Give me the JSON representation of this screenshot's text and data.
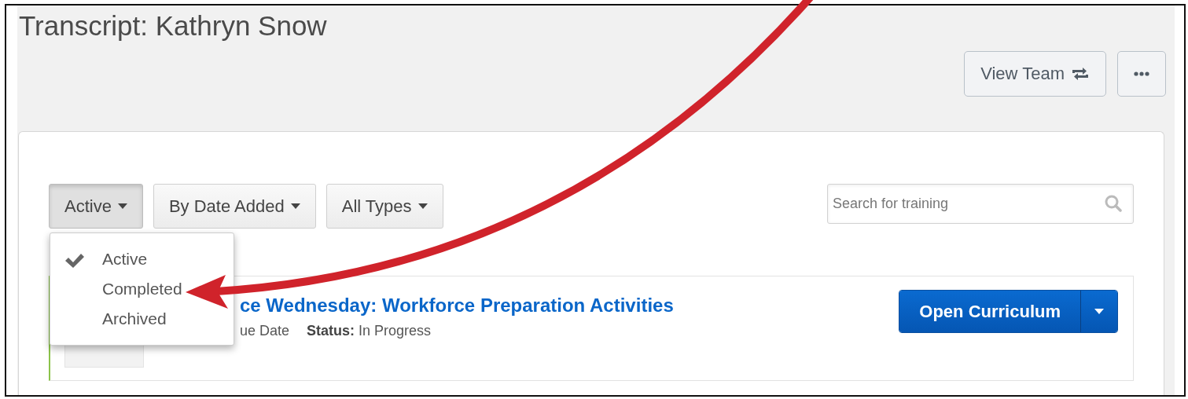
{
  "page": {
    "title": "Transcript: Kathryn Snow"
  },
  "header_buttons": [
    {
      "kind": "view_team",
      "label": "View Team"
    },
    {
      "kind": "more"
    }
  ],
  "filters": [
    {
      "label": "Active",
      "expanded": true
    },
    {
      "label": "By Date Added",
      "expanded": false
    },
    {
      "label": "All Types",
      "expanded": false
    }
  ],
  "search": {
    "placeholder": "Search for training"
  },
  "status_menu": {
    "items": [
      {
        "label": "Active",
        "checked": true
      },
      {
        "label": "Completed",
        "checked": false
      },
      {
        "label": "Archived",
        "checked": false
      }
    ]
  },
  "training": [
    {
      "title": "ce Wednesday: Workforce Preparation Activities",
      "due": "ue Date",
      "status": "**Status:** In Progress",
      "action": "Open Curriculum"
    }
  ]
}
